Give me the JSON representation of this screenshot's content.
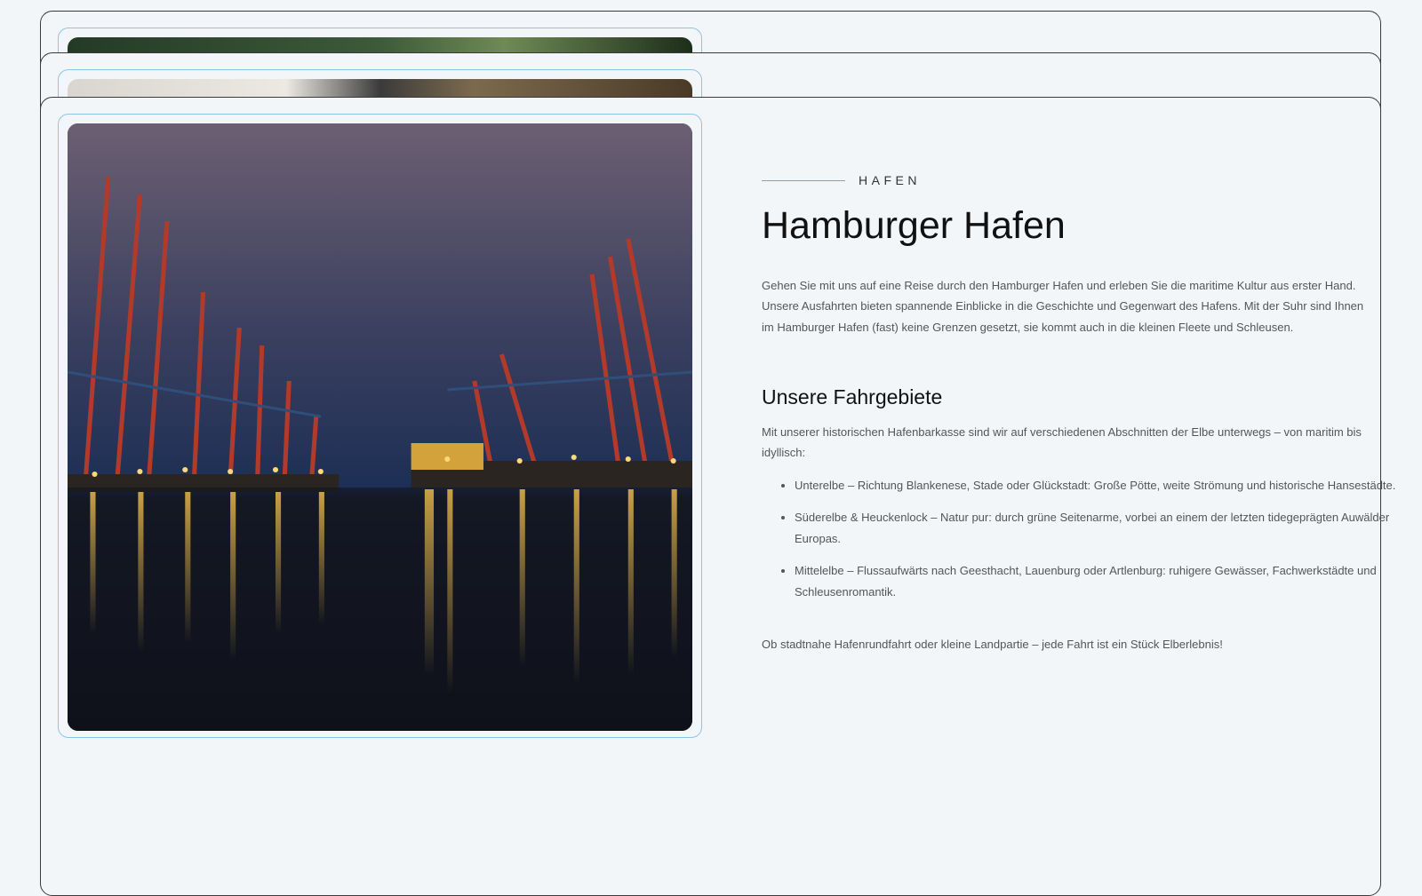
{
  "sections": [
    {
      "image_alt": "Elbe river landscape with forest and plants"
    },
    {
      "image_alt": "Historic harbour barge detail"
    }
  ],
  "main": {
    "image_alt": "Hamburg container terminal at night with cranes reflected in the Elbe",
    "kicker": "HAFEN",
    "title": "Hamburger Hafen",
    "intro": "Gehen Sie mit uns auf eine Reise durch den Hamburger Hafen und erleben Sie die maritime Kultur aus erster Hand. Unsere Ausfahrten bieten spannende Einblicke in die Geschichte und Gegenwart des Hafens. Mit der Suhr sind Ihnen im Hamburger Hafen (fast) keine Grenzen gesetzt, sie kommt auch in die kleinen Fleete und Schleusen.",
    "subtitle": "Unsere Fahrgebiete",
    "description": "Mit unserer historischen Hafenbarkasse sind wir auf verschiedenen Abschnitten der Elbe unterwegs – von maritim bis idyllisch:",
    "areas": [
      "Unterelbe – Richtung Blankenese, Stade oder Glückstadt: Große Pötte, weite Strömung und historische Hansestädte.",
      "Süderelbe & Heuckenlock – Natur pur: durch grüne Seitenarme, vorbei an einem der letzten tidegeprägten Auwälder Europas.",
      "Mittelelbe – Flussaufwärts nach Geesthacht, Lauenburg oder Artlenburg: ruhigere Gewässer, Fachwerkstädte und Schleusenromantik."
    ],
    "closing": "Ob stadtnahe Hafenrundfahrt oder kleine Landpartie – jede Fahrt ist ein Stück Elberlebnis!"
  },
  "colors": {
    "accent": "#6aa9d2",
    "background": "#f2f6f9",
    "text": "#555555",
    "heading": "#111111"
  }
}
